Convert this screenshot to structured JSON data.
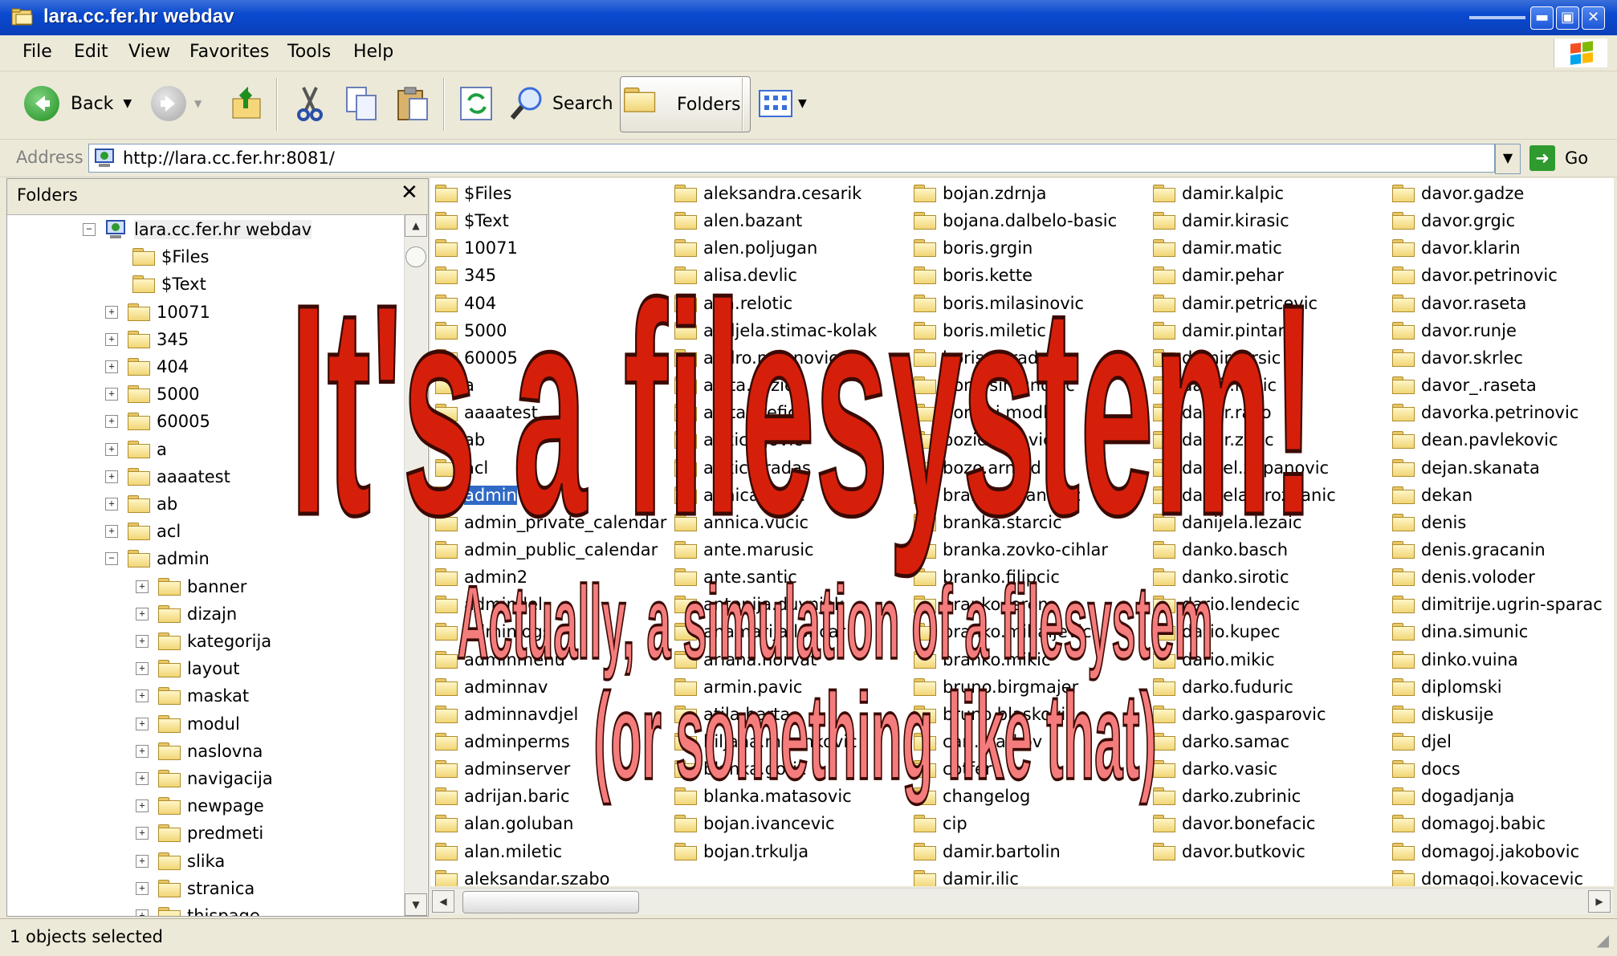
{
  "window": {
    "title": "lara.cc.fer.hr webdav",
    "controls": {
      "minimize": "▬",
      "maximize": "▣",
      "close": "✕"
    }
  },
  "menu": [
    "File",
    "Edit",
    "View",
    "Favorites",
    "Tools",
    "Help"
  ],
  "toolbar": {
    "back_label": "Back",
    "search_label": "Search",
    "folders_label": "Folders"
  },
  "address": {
    "label": "Address",
    "value": "http://lara.cc.fer.hr:8081/",
    "go_label": "Go"
  },
  "folders_pane": {
    "title": "Folders",
    "close": "✕",
    "root": "lara.cc.fer.hr webdav",
    "top_items": [
      {
        "label": "$Files",
        "expander": ""
      },
      {
        "label": "$Text",
        "expander": ""
      },
      {
        "label": "10071",
        "expander": "+"
      },
      {
        "label": "345",
        "expander": "+"
      },
      {
        "label": "404",
        "expander": "+"
      },
      {
        "label": "5000",
        "expander": "+"
      },
      {
        "label": "60005",
        "expander": "+"
      },
      {
        "label": "a",
        "expander": "+"
      },
      {
        "label": "aaaatest",
        "expander": "+"
      },
      {
        "label": "ab",
        "expander": "+"
      },
      {
        "label": "acl",
        "expander": "+"
      },
      {
        "label": "admin",
        "expander": "−"
      }
    ],
    "admin_children": [
      "banner",
      "dizajn",
      "kategorija",
      "layout",
      "maskat",
      "modul",
      "naslovna",
      "navigacija",
      "newpage",
      "predmeti",
      "slika",
      "stranica",
      "thispage"
    ]
  },
  "files": {
    "columns": [
      [
        "$Files",
        "$Text",
        "10071",
        "345",
        "404",
        "5000",
        "60005",
        "a",
        "aaaatest",
        "ab",
        "acl",
        "admin",
        "admin_private_calendar",
        "admin_public_calendar",
        "admin2",
        "admindel",
        "adminlogs",
        "adminmenu",
        "adminnav",
        "adminnavdjel",
        "adminperms",
        "adminserver",
        "adrijan.baric",
        "alan.goluban",
        "alan.miletic",
        "aleksandar.szabo"
      ],
      [
        "aleksandra.cesarik",
        "alen.bazant",
        "alen.poljugan",
        "alisa.devlic",
        "ana.relotic",
        "andjela.stimac-kolak",
        "andro.milanovic",
        "anita.zuzic",
        "anita.stefic",
        "ankica.jovic",
        "ankica.radas",
        "annica.katic",
        "annica.vucic",
        "ante.marusic",
        "ante.santic",
        "antonija.duvnjak",
        "anamarija.loncar",
        "ariana.horvat",
        "armin.pavic",
        "atila.barta",
        "biljana.marinkovic",
        "blanka.gotic",
        "blanka.matasovic",
        "bojan.ivancevic",
        "bojan.trkulja"
      ],
      [
        "bojan.zdrnja",
        "bojana.dalbelo-basic",
        "boris.grgin",
        "boris.kette",
        "boris.milasinovic",
        "boris.miletic",
        "boris.obradovic",
        "boris.simunovic",
        "borivoj.modlic",
        "bozidar.kovic",
        "bozo.arnold",
        "branka.fisanovic",
        "branka.starcic",
        "branka.zovko-cihlar",
        "branko.filipcic",
        "branko.jeren",
        "branko.mihaljevic",
        "branko.mikic",
        "bruno.birgmajer",
        "bruno.blaskovic",
        "carl.markov",
        "cotfer",
        "changelog",
        "cip",
        "damir.bartolin",
        "damir.ilic"
      ],
      [
        "damir.kalpic",
        "damir.kirasic",
        "damir.matic",
        "damir.pehar",
        "damir.petricevic",
        "damir.pintar",
        "damir.mrsic",
        "damir.radic",
        "damir.rako",
        "damir.zmic",
        "danijel.zupanovic",
        "danijela.grozdanic",
        "danijela.lezaic",
        "danko.basch",
        "danko.sirotic",
        "dario.lendecic",
        "dario.kupec",
        "dario.mikic",
        "darko.fuduric",
        "darko.gasparovic",
        "darko.samac",
        "darko.vasic",
        "darko.zubrinic",
        "davor.bonefacic",
        "davor.butkovic"
      ],
      [
        "davor.gadze",
        "davor.grgic",
        "davor.klarin",
        "davor.petrinovic",
        "davor.raseta",
        "davor.runje",
        "davor.skrlec",
        "davor_.raseta",
        "davorka.petrinovic",
        "dean.pavlekovic",
        "dejan.skanata",
        "dekan",
        "denis",
        "denis.gracanin",
        "denis.voloder",
        "dimitrije.ugrin-sparac",
        "dina.simunic",
        "dinko.vuina",
        "diplomski",
        "diskusije",
        "djel",
        "docs",
        "dogadjanja",
        "domagoj.babic",
        "domagoj.jakobovic",
        "domagoj.kovacevic"
      ]
    ],
    "selected": "admin"
  },
  "status": {
    "text": "1 objects selected"
  },
  "overlay": {
    "headline": "It's a filesystem!",
    "line1": "Actually, a simulation of a filesystem",
    "line2": "(or something like that)"
  }
}
